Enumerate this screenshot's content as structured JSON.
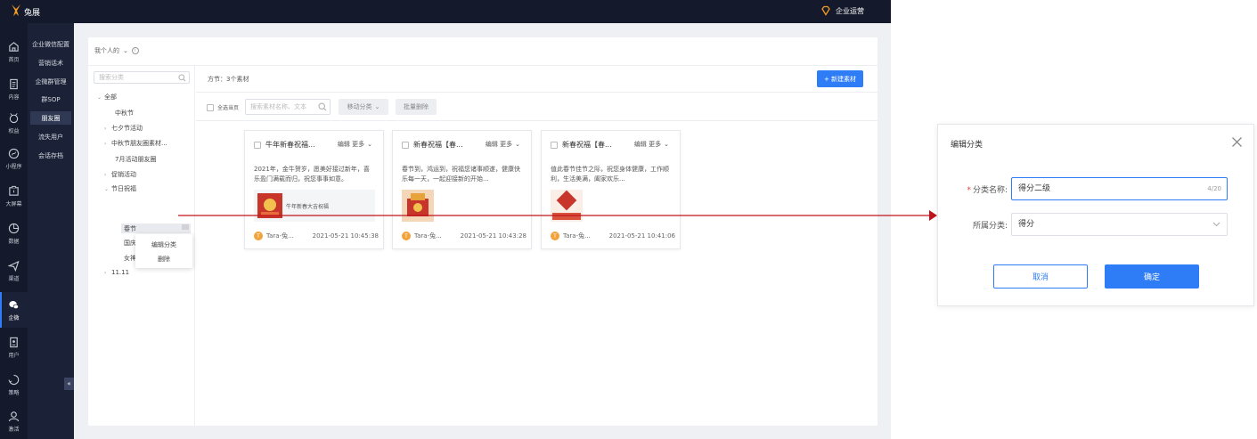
{
  "topbar": {
    "logo_text": "兔展",
    "enterprise_label": "企业运营"
  },
  "leftnav": [
    {
      "icon": "home-icon",
      "label": "首页"
    },
    {
      "icon": "content-icon",
      "label": "内容"
    },
    {
      "icon": "rights-icon",
      "label": "权益"
    },
    {
      "icon": "mini-program-icon",
      "label": "小程序"
    },
    {
      "icon": "big-screen-icon",
      "label": "大屏幕"
    },
    {
      "icon": "data-icon",
      "label": "数据"
    },
    {
      "icon": "send-icon",
      "label": "渠道"
    },
    {
      "icon": "wechat-work-icon",
      "label": "企微"
    },
    {
      "icon": "user-icon",
      "label": "用户"
    },
    {
      "icon": "strategy-icon",
      "label": "策略"
    },
    {
      "icon": "person-icon",
      "label": "激活"
    }
  ],
  "subnav": [
    "企业微信配置",
    "营销话术",
    "企微群管理",
    "群SOP",
    "朋友圈",
    "流失用户",
    "会话存档"
  ],
  "panel": {
    "scope_label": "我个人的",
    "tree_search_placeholder": "搜索分类",
    "tree": [
      "全部",
      "中秋节",
      "七夕节活动",
      "中秋节朋友圈素材...",
      "7月活动朋友圈",
      "促销活动",
      "节日祝福",
      "春节",
      "国庆",
      "女神",
      "11.11"
    ],
    "context_menu": [
      "编辑分类",
      "删除"
    ],
    "count_label": "方节：3个素材",
    "new_button": "+ 新建素材",
    "select_all": "全选当页",
    "material_search_placeholder": "搜索素材名称、文本",
    "move_button": "移动分类",
    "batch_delete": "批量删除"
  },
  "cards": [
    {
      "title": "牛年新春祝福...",
      "edit": "编辑 更多",
      "desc": "2021年，金牛贺岁，愿美好接过新年，喜乐盈门满载而归，祝您事事如意。",
      "media": "link",
      "link_text": "牛年新春大吉祝福",
      "author": "Tara-兔...",
      "date": "2021-05-21 10:45:38"
    },
    {
      "title": "新春祝福【春...",
      "edit": "编辑 更多",
      "desc": "春节到，鸿运到，祝福您诸事顺遂，健康快乐每一天，一起迎接新的开始...",
      "media": "image",
      "author": "Tara-兔...",
      "date": "2021-05-21 10:43:28"
    },
    {
      "title": "新春祝福【春...",
      "edit": "编辑 更多",
      "desc": "值此春节佳节之际，祝您身体健康，工作顺利，生活美满，阖家欢乐...",
      "media": "image",
      "author": "Tara-兔...",
      "date": "2021-05-21 10:41:06"
    }
  ],
  "dialog": {
    "title": "编辑分类",
    "name_label": "分类名称:",
    "name_value": "得分二级",
    "name_count": "4/20",
    "parent_label": "所属分类:",
    "parent_value": "得分",
    "cancel": "取消",
    "ok": "确定"
  },
  "colors": {
    "primary": "#2f7df6",
    "nav_bg": "#141a2b",
    "subnav_bg": "#1b2237",
    "connector": "#c0141c"
  }
}
